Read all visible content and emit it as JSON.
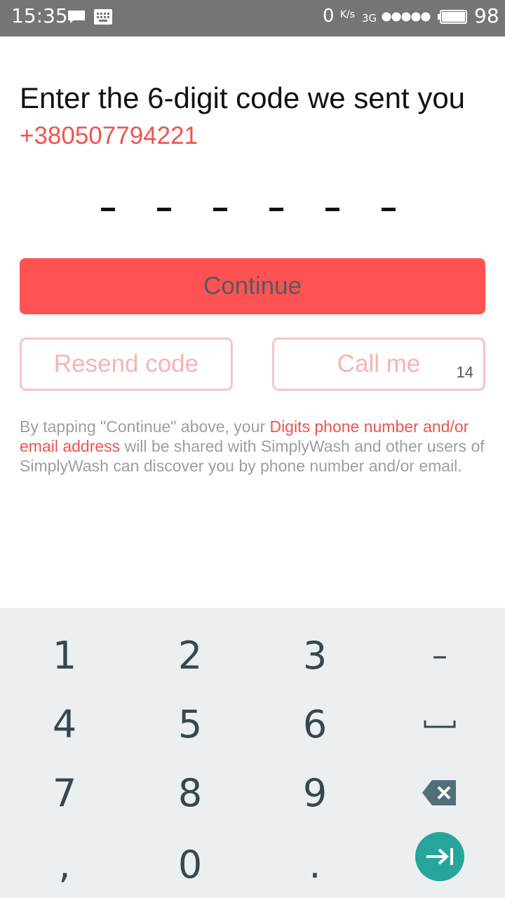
{
  "status_bar": {
    "time": "15:35",
    "speed": "0",
    "speed_unit": "K/s",
    "network": "3G",
    "battery": "98",
    "icons": [
      "message-icon",
      "keyboard-icon",
      "signal-icon",
      "battery-icon"
    ]
  },
  "verify": {
    "title": "Enter the 6-digit code we sent you",
    "phone": "+380507794221",
    "code_length": 6
  },
  "buttons": {
    "continue": "Continue",
    "resend": "Resend code",
    "call_me": "Call me",
    "call_countdown": "14"
  },
  "disclaimer": {
    "part1": "By tapping \"Continue\" above, your ",
    "highlight": "Digits phone number and/or email address",
    "part2": " will be shared with SimplyWash and other users of SimplyWash can discover you by phone number and/or email."
  },
  "keypad": {
    "keys": [
      "1",
      "2",
      "3",
      "–",
      "4",
      "5",
      "6",
      "space",
      "7",
      "8",
      "9",
      "backspace",
      ",",
      "0",
      ".",
      "next"
    ],
    "icons": [
      "space-icon",
      "backspace-icon",
      "next-icon"
    ]
  },
  "colors": {
    "accent": "#ff5252",
    "accent_text": "#ef5350",
    "outline": "#f9c3c3",
    "status_bar": "#757575",
    "keypad_bg": "#eceff1",
    "fab": "#26a69a"
  }
}
